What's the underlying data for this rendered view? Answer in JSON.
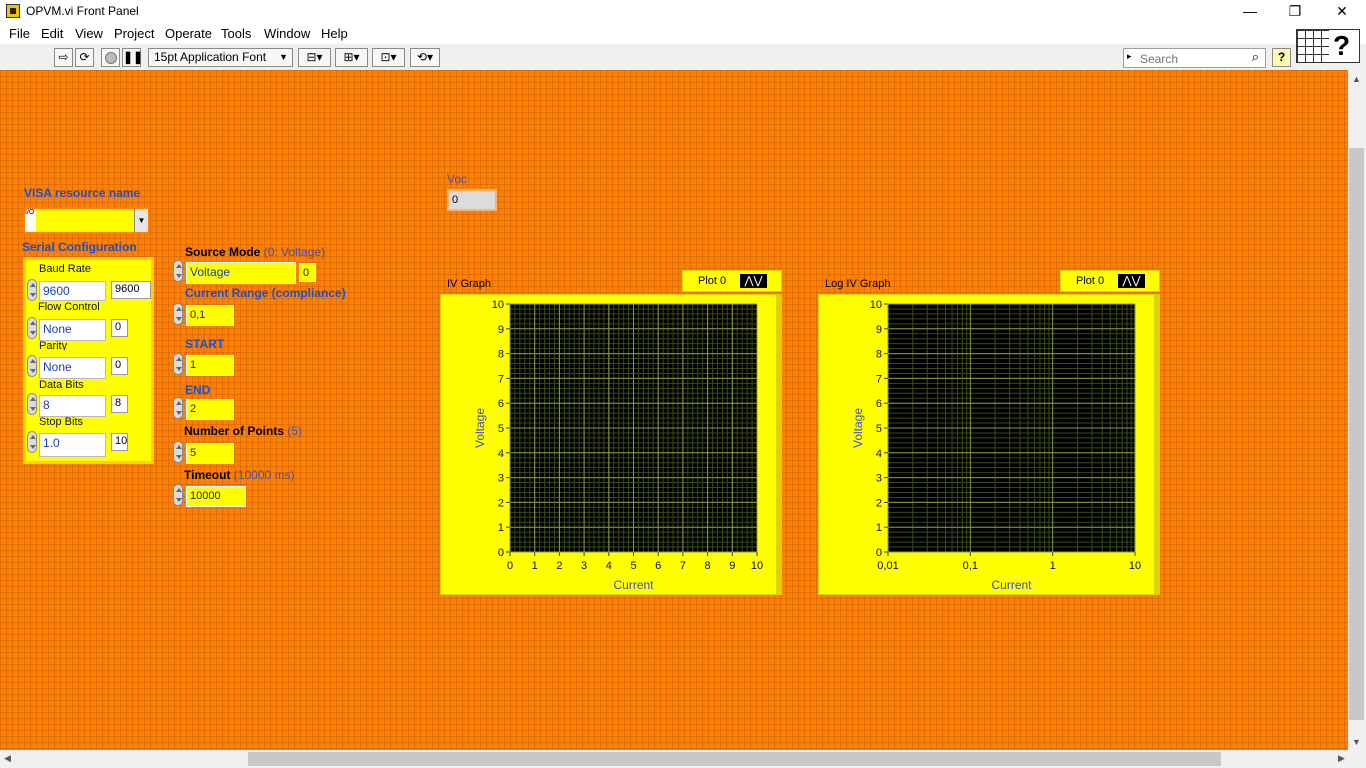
{
  "window": {
    "title": "OPVM.vi Front Panel",
    "minimize": "—",
    "restore": "❐",
    "close": "✕"
  },
  "menu": [
    "File",
    "Edit",
    "View",
    "Project",
    "Operate",
    "Tools",
    "Window",
    "Help"
  ],
  "toolbar": {
    "font": "15pt Application Font",
    "search_placeholder": "Search"
  },
  "visa": {
    "label": "VISA resource name",
    "value": "",
    "io_glyph": "I/O"
  },
  "serial": {
    "label": "Serial Configuration",
    "baud": {
      "label": "Baud Rate",
      "value": "9600",
      "indicator": "9600"
    },
    "flow": {
      "label": "Flow Control",
      "value": "None",
      "indicator": "0"
    },
    "parity": {
      "label": "Parity",
      "value": "None",
      "indicator": "0"
    },
    "databits": {
      "label": "Data Bits",
      "value": "8",
      "indicator": "8"
    },
    "stopbits": {
      "label": "Stop Bits",
      "value": "1.0",
      "indicator": "10"
    }
  },
  "source_mode": {
    "label": "Source Mode",
    "hint": "(0: Voltage)",
    "value": "Voltage",
    "indicator": "0"
  },
  "current_range": {
    "label": "Current Range (compliance)",
    "value": "0,1"
  },
  "start": {
    "label": "START",
    "value": "1"
  },
  "end": {
    "label": "END",
    "value": "2"
  },
  "num_points": {
    "label": "Number of Points",
    "hint": "(5)",
    "value": "5"
  },
  "timeout": {
    "label": "Timeout",
    "hint": "(10000 ms)",
    "value": "10000"
  },
  "voc": {
    "label": "Voc",
    "value": "0"
  },
  "chart_data": [
    {
      "type": "line",
      "title": "IV Graph",
      "legend": "Plot 0",
      "xlabel": "Current",
      "ylabel": "Voltage",
      "xlim": [
        0,
        10
      ],
      "ylim": [
        0,
        10
      ],
      "xscale": "linear",
      "grid": true,
      "series": [],
      "xticks": [
        "0",
        "1",
        "2",
        "3",
        "4",
        "5",
        "6",
        "7",
        "8",
        "9",
        "10"
      ],
      "yticks": [
        "0",
        "1",
        "2",
        "3",
        "4",
        "5",
        "6",
        "7",
        "8",
        "9",
        "10"
      ]
    },
    {
      "type": "line",
      "title": "Log IV Graph",
      "legend": "Plot 0",
      "xlabel": "Current",
      "ylabel": "Voltage",
      "xlim": [
        0.01,
        10
      ],
      "ylim": [
        0,
        10
      ],
      "xscale": "log",
      "grid": true,
      "series": [],
      "xticks": [
        "0,01",
        "0,1",
        "1",
        "10"
      ],
      "yticks": [
        "0",
        "1",
        "2",
        "3",
        "4",
        "5",
        "6",
        "7",
        "8",
        "9",
        "10"
      ]
    }
  ]
}
